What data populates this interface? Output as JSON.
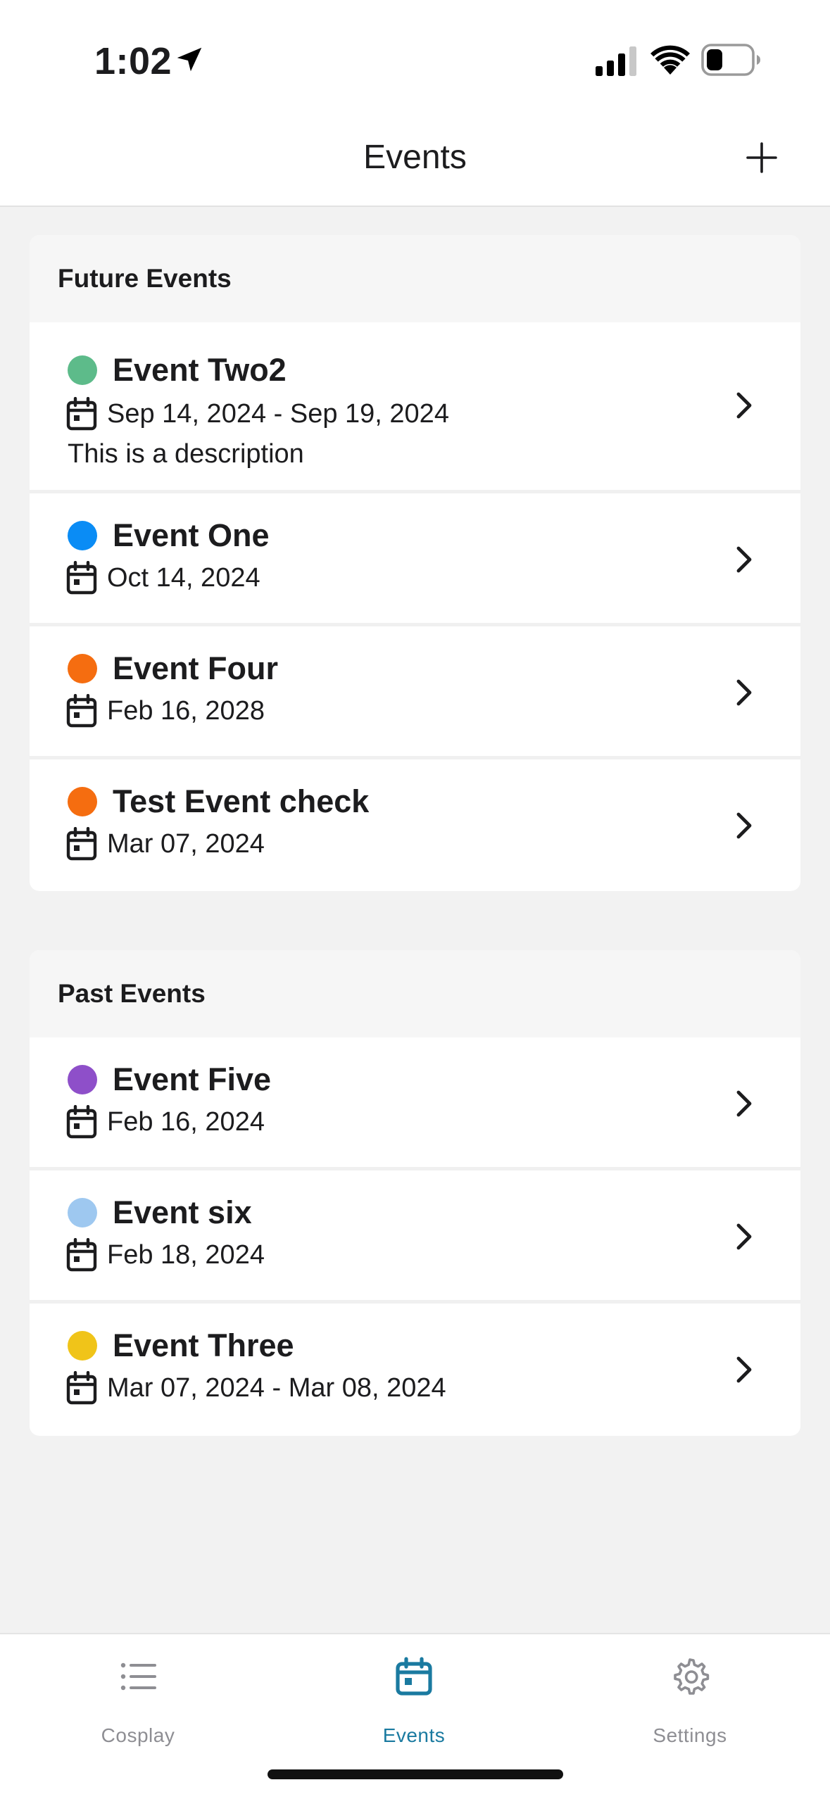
{
  "status_bar": {
    "time": "1:02"
  },
  "nav": {
    "title": "Events"
  },
  "sections": [
    {
      "header": "Future Events",
      "events": [
        {
          "title": "Event Two2",
          "date": "Sep 14, 2024 - Sep 19, 2024",
          "description": "This is a description",
          "color": "#5dbb8a"
        },
        {
          "title": "Event One",
          "date": "Oct 14, 2024",
          "color": "#0a8cf5"
        },
        {
          "title": "Event Four",
          "date": "Feb 16, 2028",
          "color": "#f56d10"
        },
        {
          "title": "Test Event check",
          "date": "Mar 07, 2024",
          "color": "#f56d10"
        }
      ]
    },
    {
      "header": "Past Events",
      "events": [
        {
          "title": "Event Five",
          "date": "Feb 16, 2024",
          "color": "#8e4fc9"
        },
        {
          "title": "Event six",
          "date": "Feb 18, 2024",
          "color": "#9ec8f0"
        },
        {
          "title": "Event Three",
          "date": "Mar 07, 2024 - Mar 08, 2024",
          "color": "#f0c419"
        }
      ]
    }
  ],
  "tabs": [
    {
      "label": "Cosplay",
      "icon": "list-icon"
    },
    {
      "label": "Events",
      "icon": "calendar-icon",
      "active": true
    },
    {
      "label": "Settings",
      "icon": "gear-icon"
    }
  ],
  "colors": {
    "accent": "#1a7aa0",
    "inactive": "#8e8e93"
  }
}
